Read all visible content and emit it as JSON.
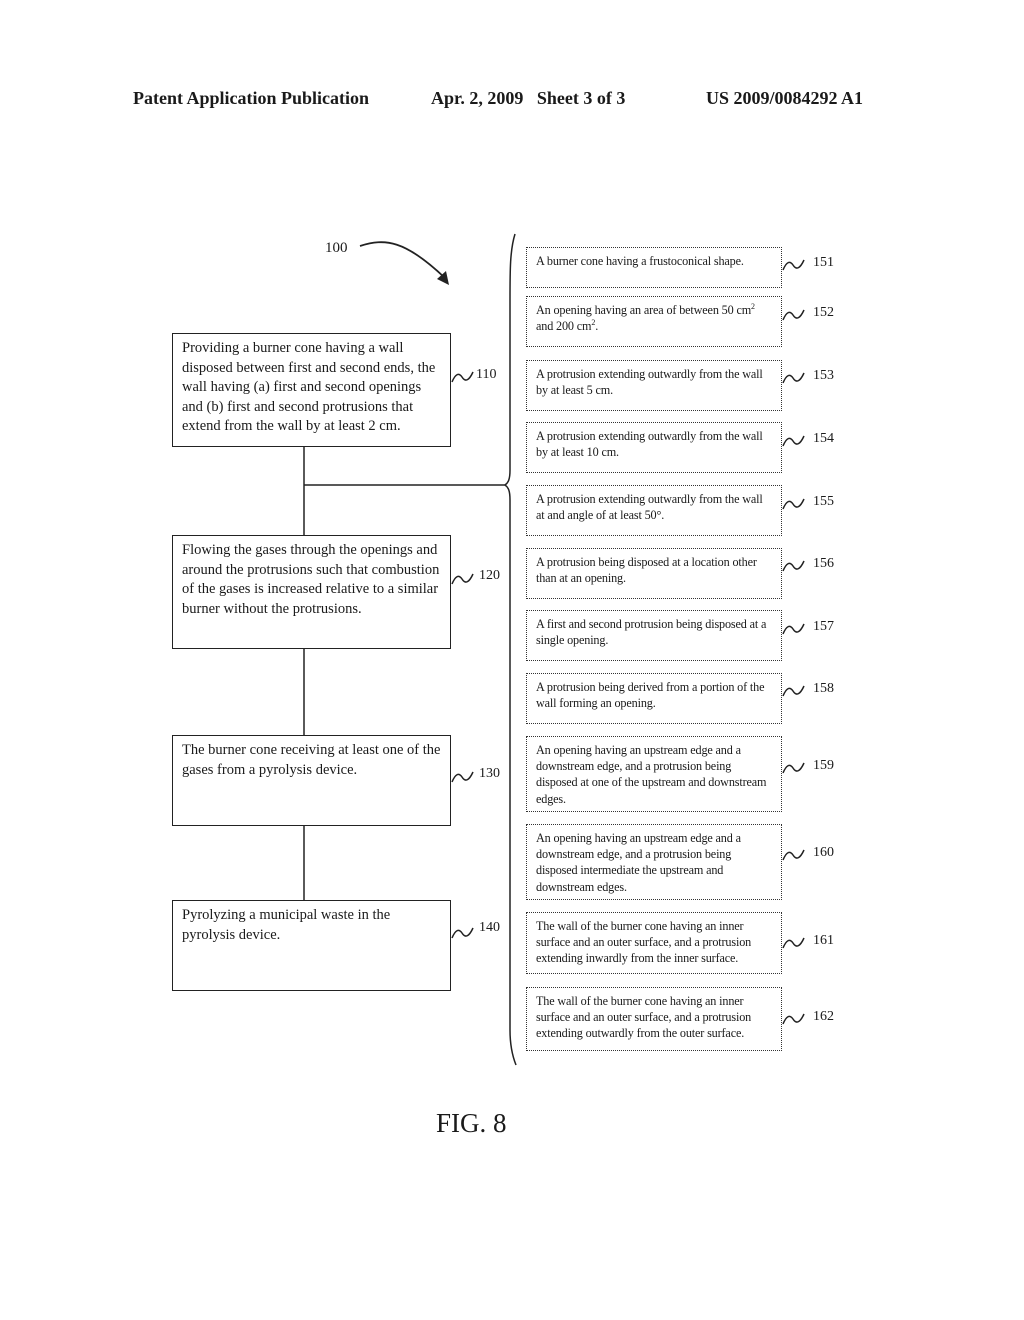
{
  "header": {
    "publication": "Patent Application Publication",
    "date_sheet": "Apr. 2, 2009   Sheet 3 of 3",
    "patent_number": "US 2009/0084292 A1"
  },
  "diagram": {
    "method_ref": "100",
    "steps": [
      {
        "ref": "110",
        "text": "Providing a burner cone having a wall disposed between first and second ends, the wall having (a) first and second openings and (b) first and second protrusions that extend from the wall by at least 2 cm."
      },
      {
        "ref": "120",
        "text": "Flowing the gases through the openings and around the protrusions such that combustion of the gases is increased relative to a similar burner without the protrusions."
      },
      {
        "ref": "130",
        "text": "The burner cone receiving at least one of the gases from a pyrolysis device."
      },
      {
        "ref": "140",
        "text": "Pyrolyzing a municipal waste in the pyrolysis device."
      }
    ],
    "options": [
      {
        "ref": "151",
        "text": "A burner cone having a frustoconical shape."
      },
      {
        "ref": "152",
        "text_parts": [
          "An opening having an area of between 50 cm",
          "2",
          " and 200 cm",
          "2",
          "."
        ]
      },
      {
        "ref": "153",
        "text": "A protrusion extending outwardly from the wall by at least 5 cm."
      },
      {
        "ref": "154",
        "text": "A protrusion extending outwardly from the wall by at least 10 cm."
      },
      {
        "ref": "155",
        "text": "A protrusion extending outwardly from the wall at and angle of at least 50°."
      },
      {
        "ref": "156",
        "text": "A protrusion being disposed at a location other than at an opening."
      },
      {
        "ref": "157",
        "text": "A first and second protrusion being disposed at a single opening."
      },
      {
        "ref": "158",
        "text": "A protrusion being derived from a portion of the wall forming an opening."
      },
      {
        "ref": "159",
        "text": "An opening having an upstream edge and a downstream edge, and a protrusion being disposed at one of the upstream and downstream edges."
      },
      {
        "ref": "160",
        "text": "An opening having an upstream edge and a downstream edge, and a protrusion being disposed intermediate the upstream and downstream edges."
      },
      {
        "ref": "161",
        "text": "The wall of the burner cone having an inner surface and an outer surface, and a protrusion extending inwardly from the inner surface."
      },
      {
        "ref": "162",
        "text": "The wall of the burner cone having an inner surface and an outer surface, and a protrusion extending outwardly from the outer surface."
      }
    ]
  },
  "figure_label": "FIG. 8"
}
